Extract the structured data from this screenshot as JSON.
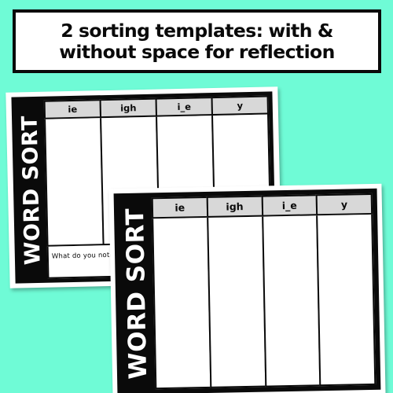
{
  "background_color": "#6ffbd6",
  "banner": {
    "line1": "2 sorting templates: with &",
    "line2": "without space for reflection",
    "text_color": "#0a0a0a",
    "border_color": "#0a0a0a",
    "fill_color": "#ffffff"
  },
  "worksheets": [
    {
      "id": "worksheet-with-reflection",
      "sidebar_label": "WORD SORT",
      "columns": [
        {
          "header": "ie"
        },
        {
          "header": "igh"
        },
        {
          "header": "i_e"
        },
        {
          "header": "y"
        }
      ],
      "reflection_prompt": "What do you notice?",
      "has_reflection": true,
      "header_fill": "#d8d8d8",
      "frame_color": "#0a0a0a",
      "page_color": "#ffffff"
    },
    {
      "id": "worksheet-without-reflection",
      "sidebar_label": "WORD SORT",
      "columns": [
        {
          "header": "ie"
        },
        {
          "header": "igh"
        },
        {
          "header": "i_e"
        },
        {
          "header": "y"
        }
      ],
      "reflection_prompt": "",
      "has_reflection": false,
      "header_fill": "#d8d8d8",
      "frame_color": "#0a0a0a",
      "page_color": "#ffffff"
    }
  ]
}
